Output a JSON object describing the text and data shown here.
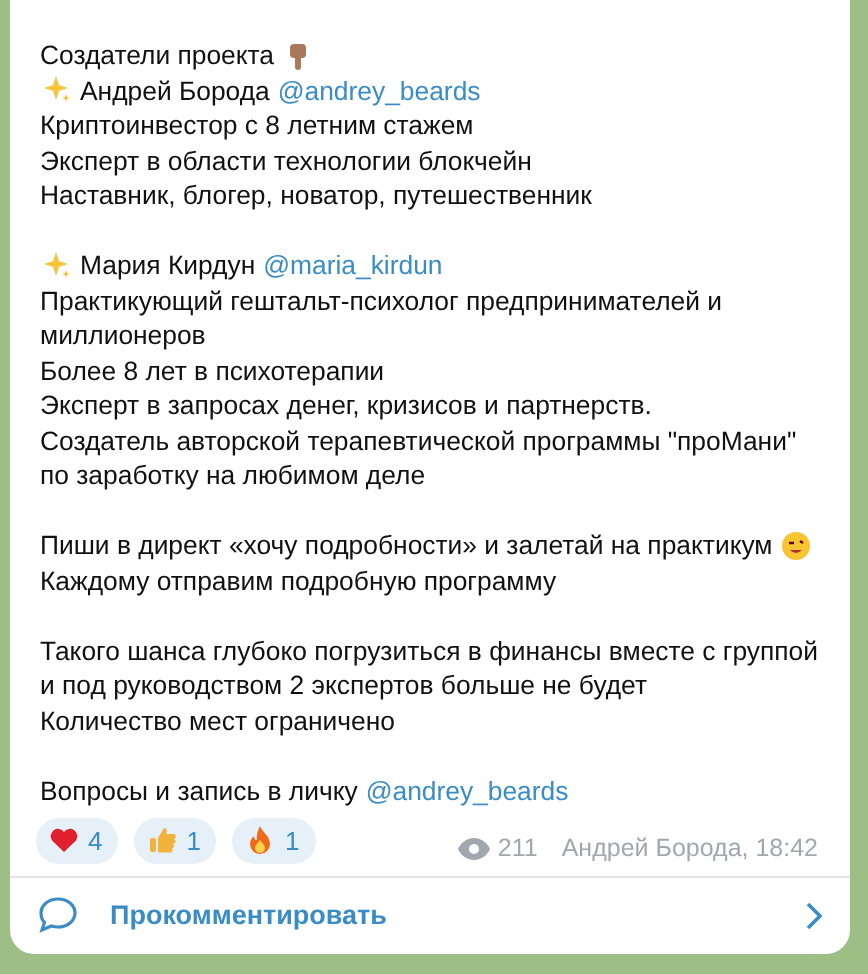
{
  "post": {
    "paragraphs": [
      {
        "lines": [
          {
            "text": "Создатели проекта",
            "pointing_down": true
          },
          {
            "sparkles": true,
            "text": "Андрей Борода",
            "mention": "@andrey_beards"
          },
          {
            "text": "Криптоинвестор с 8 летним стажем"
          },
          {
            "text": "Эксперт в области технологии блокчейн"
          },
          {
            "text": "Наставник, блогер, новатор, путешественник"
          }
        ]
      },
      {
        "lines": [
          {
            "sparkles": true,
            "text": "Мария Кирдун",
            "mention": "@maria_kirdun"
          },
          {
            "text": "Практикующий гештальт-психолог предпринимателей и"
          },
          {
            "text": "миллионеров"
          },
          {
            "text": "Более 8 лет в психотерапии"
          },
          {
            "text": "Эксперт в запросах денег, кризисов и партнерств."
          },
          {
            "text": "Создатель авторской терапевтической программы \"проМани\""
          },
          {
            "text": "по заработку на любимом деле"
          }
        ]
      },
      {
        "lines": [
          {
            "text": "Пиши в директ «хочу подробности» и залетай на практикум",
            "wink": true
          },
          {
            "text": "Каждому отправим подробную программу"
          }
        ]
      },
      {
        "lines": [
          {
            "text": "Такого шанса глубоко погрузиться в финансы вместе с группой"
          },
          {
            "text": "и под руководством 2 экспертов больше не будет"
          },
          {
            "text": "Количество мест ограничено"
          }
        ]
      },
      {
        "lines": [
          {
            "text": "Вопросы и запись в личку",
            "mention": "@andrey_beards"
          }
        ]
      }
    ],
    "reactions": [
      {
        "kind": "heart",
        "count": "4"
      },
      {
        "kind": "thumbs-up",
        "count": "1"
      },
      {
        "kind": "fire",
        "count": "1"
      }
    ],
    "views": "211",
    "signature": "Андрей Борода, 18:42"
  },
  "comments": {
    "label": "Прокомментировать"
  }
}
